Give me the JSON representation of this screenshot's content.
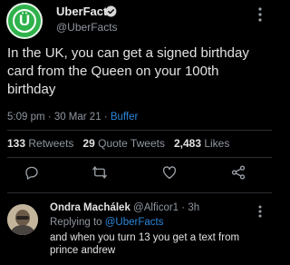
{
  "tweet": {
    "display_name": "UberFacts",
    "handle": "@UberFacts",
    "avatar_letter": "Ü",
    "text": "In the UK, you can get a signed birthday card from the Queen on your 100th birthday",
    "time": "5:09 pm",
    "date": "30 Mar 21",
    "separator": "·",
    "source": "Buffer",
    "stats": {
      "retweets_count": "133",
      "retweets_label": "Retweets",
      "quote_count": "29",
      "quote_label": "Quote Tweets",
      "likes_count": "2,483",
      "likes_label": "Likes"
    }
  },
  "actions": [
    "reply-icon",
    "retweet-icon",
    "like-icon",
    "share-icon"
  ],
  "reply": {
    "display_name": "Ondra Machálek",
    "handle": "@Alficor1",
    "separator": "·",
    "time": "3h",
    "replying_prefix": "Replying to",
    "replying_handle": "@UberFacts",
    "text": "and when you turn 13 you get a text from prince andrew"
  },
  "colors": {
    "background": "#000000",
    "accent": "#2b86d9",
    "avatar": "#2fb24c",
    "muted": "#8f96a0"
  }
}
